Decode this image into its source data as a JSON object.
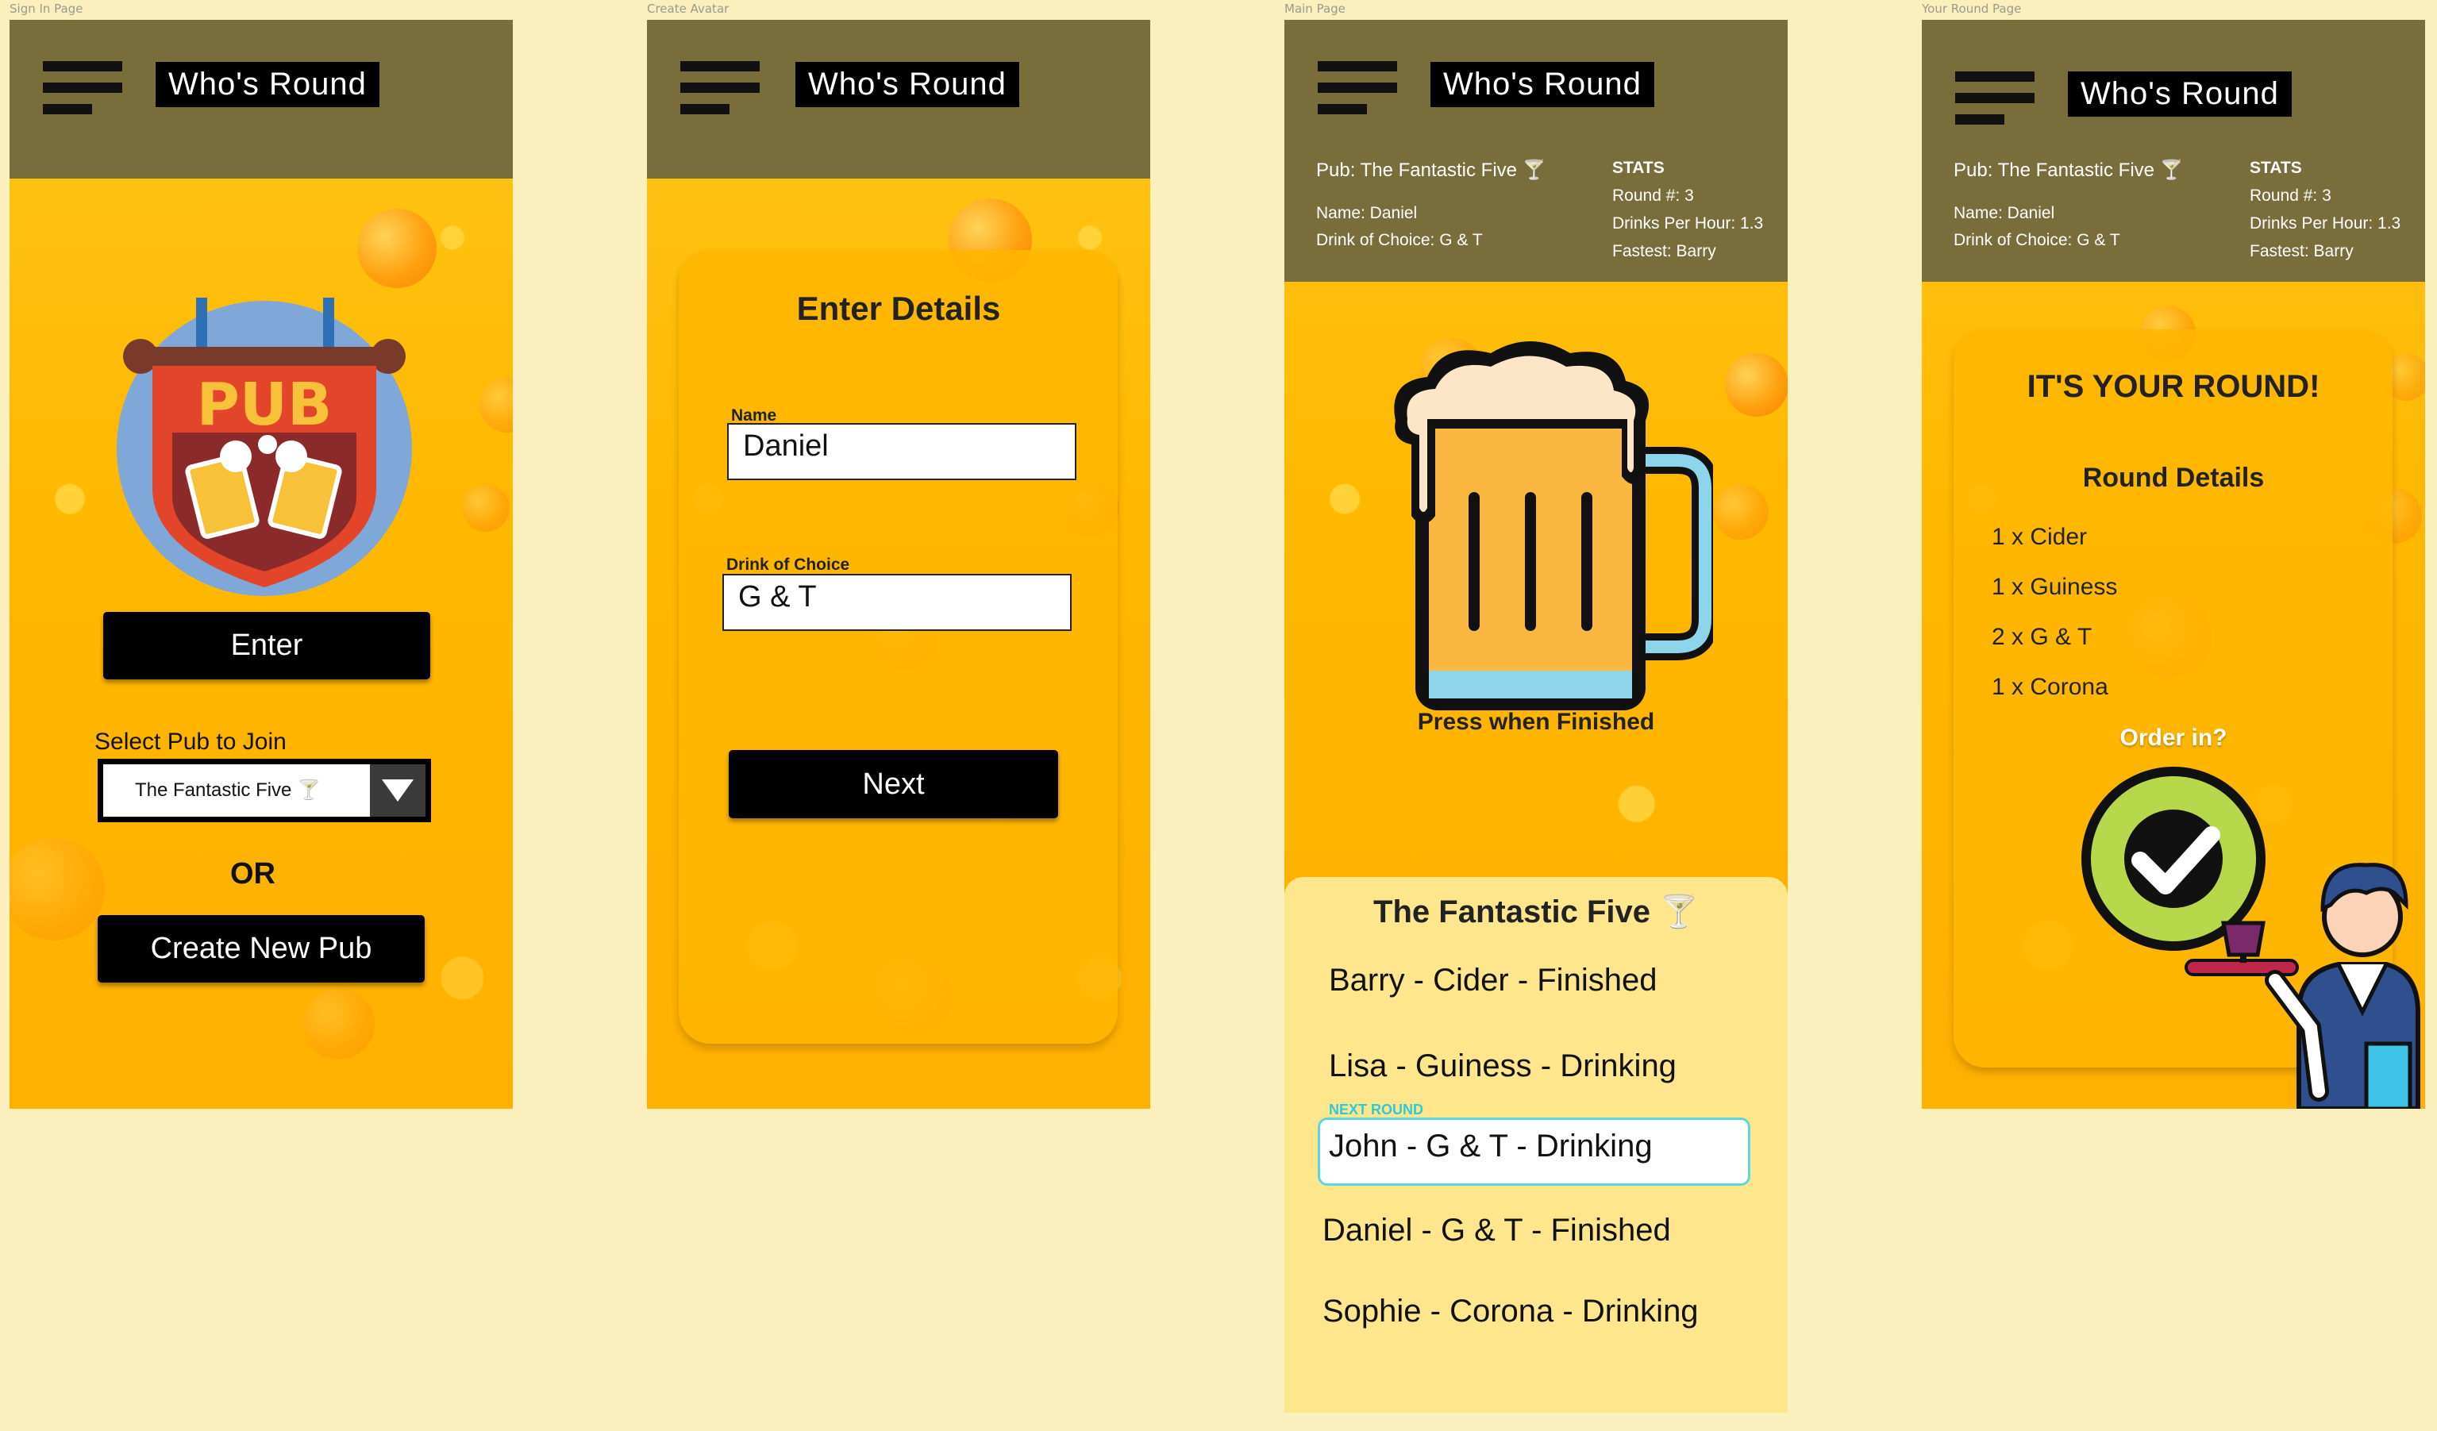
{
  "frames": {
    "sign_in": {
      "label": "Sign In Page",
      "app_title": "Who's Round",
      "enter_label": "Enter",
      "select_label": "Select Pub to Join",
      "select_value": "The Fantastic Five 🍸",
      "or_label": "OR",
      "create_label": "Create New Pub",
      "pub_sign_text": "PUB"
    },
    "create_avatar": {
      "label": "Create Avatar",
      "app_title": "Who's Round",
      "card_title": "Enter Details",
      "name_label": "Name",
      "name_value": "Daniel",
      "drink_label": "Drink of Choice",
      "drink_value": "G & T",
      "next_label": "Next"
    },
    "main": {
      "label": "Main Page",
      "app_title": "Who's Round",
      "pub": "Pub: The Fantastic Five 🍸",
      "name": "Name: Daniel",
      "drink": "Drink of Choice: G & T",
      "stats_title": "STATS",
      "round": "Round #: 3",
      "dph": "Drinks Per Hour: 1.3",
      "fastest": "Fastest: Barry",
      "press_label": "Press when Finished",
      "roster_title": "The Fantastic Five 🍸",
      "next_round_tag": "NEXT ROUND",
      "members": [
        "Barry - Cider - Finished",
        "Lisa - Guiness - Drinking",
        "John - G & T - Drinking",
        "Daniel - G & T - Finished",
        "Sophie - Corona - Drinking"
      ]
    },
    "your_round": {
      "label": "Your Round Page",
      "app_title": "Who's Round",
      "pub": "Pub: The Fantastic Five 🍸",
      "name": "Name: Daniel",
      "drink": "Drink of Choice: G & T",
      "stats_title": "STATS",
      "round": "Round #: 3",
      "dph": "Drinks Per Hour: 1.3",
      "fastest": "Fastest: Barry",
      "headline": "IT'S YOUR ROUND!",
      "details_title": "Round Details",
      "items": [
        "1 x Cider",
        "1 x Guiness",
        "2 x G & T",
        "1 x Corona"
      ],
      "order_label": "Order in?"
    }
  },
  "colors": {
    "background": "#fbefbe",
    "beer": "#ffb800",
    "header": "#7a6d3c",
    "button": "#000000",
    "roster_bg": "#fde68c",
    "next_round_accent": "#3fd6d6"
  },
  "icons": [
    "hamburger-menu-icon",
    "pub-sign-icon",
    "dropdown-arrow-icon",
    "beer-mug-icon",
    "checkmark-icon",
    "waiter-icon",
    "cocktail-glass-icon"
  ]
}
